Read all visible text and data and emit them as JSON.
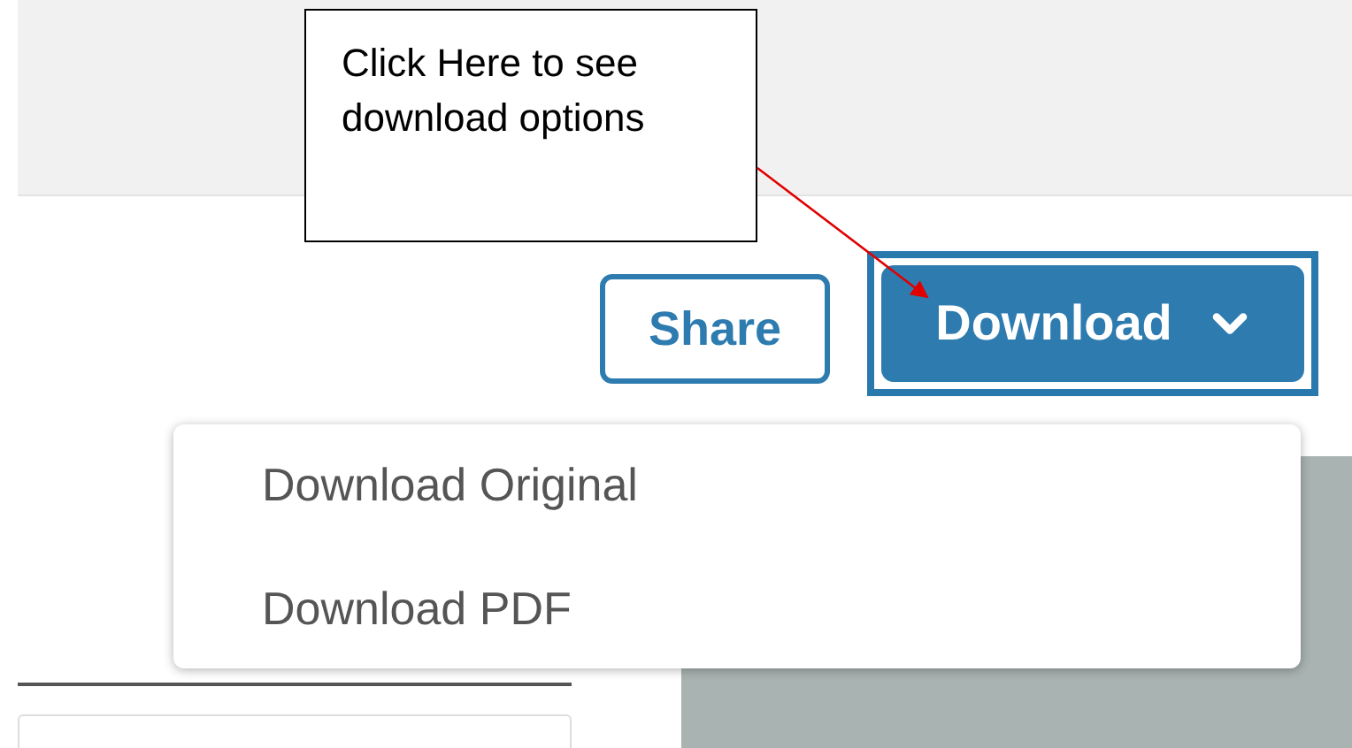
{
  "callout": {
    "text": "Click Here to see download options"
  },
  "share_button": {
    "label": "Share"
  },
  "download_button": {
    "label": "Download",
    "highlighted": true,
    "expanded": true
  },
  "download_menu": [
    {
      "label": "Download Original"
    },
    {
      "label": "Download PDF"
    }
  ]
}
